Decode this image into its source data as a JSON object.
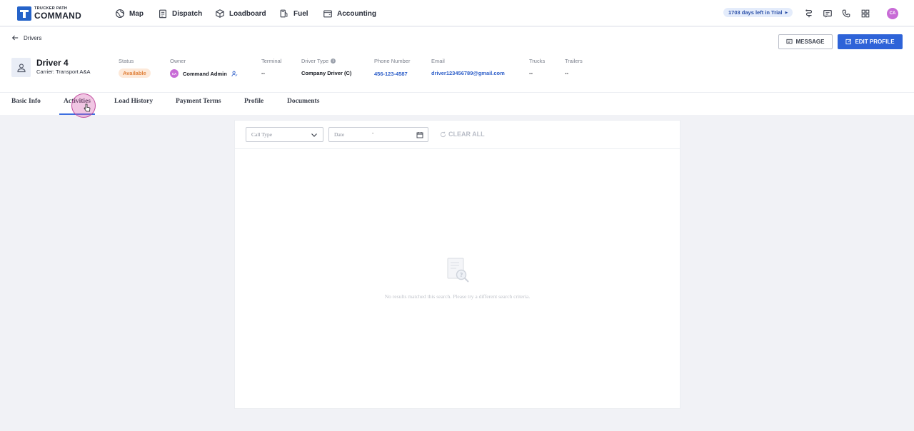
{
  "brand": {
    "small": "TRUCKER PATH",
    "big": "COMMAND"
  },
  "nav": [
    {
      "label": "Map",
      "icon": "globe-icon"
    },
    {
      "label": "Dispatch",
      "icon": "clipboard-icon"
    },
    {
      "label": "Loadboard",
      "icon": "box-icon"
    },
    {
      "label": "Fuel",
      "icon": "fuel-icon"
    },
    {
      "label": "Accounting",
      "icon": "wallet-icon"
    }
  ],
  "trial": {
    "label": "1703 days left in Trial"
  },
  "user": {
    "initials": "CA"
  },
  "header": {
    "back_label": "Drivers",
    "message_label": "MESSAGE",
    "edit_label": "EDIT PROFILE",
    "driver": {
      "name": "Driver 4",
      "carrier": "Carrier: Transport A&A"
    },
    "fields": {
      "status": {
        "label": "Status",
        "value": "Available"
      },
      "owner": {
        "label": "Owner",
        "value": "Command Admin",
        "initials": "CA"
      },
      "terminal": {
        "label": "Terminal",
        "value": "--"
      },
      "driver_type": {
        "label": "Driver Type",
        "value": "Company Driver (C)"
      },
      "phone": {
        "label": "Phone Number",
        "value": "456-123-4587"
      },
      "email": {
        "label": "Email",
        "value": "driver123456789@gmail.com"
      },
      "trucks": {
        "label": "Trucks",
        "value": "--"
      },
      "trailers": {
        "label": "Trailers",
        "value": "--"
      }
    }
  },
  "tabs": [
    {
      "label": "Basic Info"
    },
    {
      "label": "Activities",
      "active": true
    },
    {
      "label": "Load History"
    },
    {
      "label": "Payment Terms"
    },
    {
      "label": "Profile"
    },
    {
      "label": "Documents"
    }
  ],
  "filters": {
    "call_type_placeholder": "Call Type",
    "date_placeholder": "Date",
    "date_separator": "-",
    "clear_all": "CLEAR ALL"
  },
  "empty_state": {
    "message": "No results matched this search. Please try a different search criteria."
  },
  "colors": {
    "accent": "#2e63d8",
    "status_bg": "#fde9d9",
    "status_fg": "#e0803a",
    "avatar": "#c86bd6"
  }
}
